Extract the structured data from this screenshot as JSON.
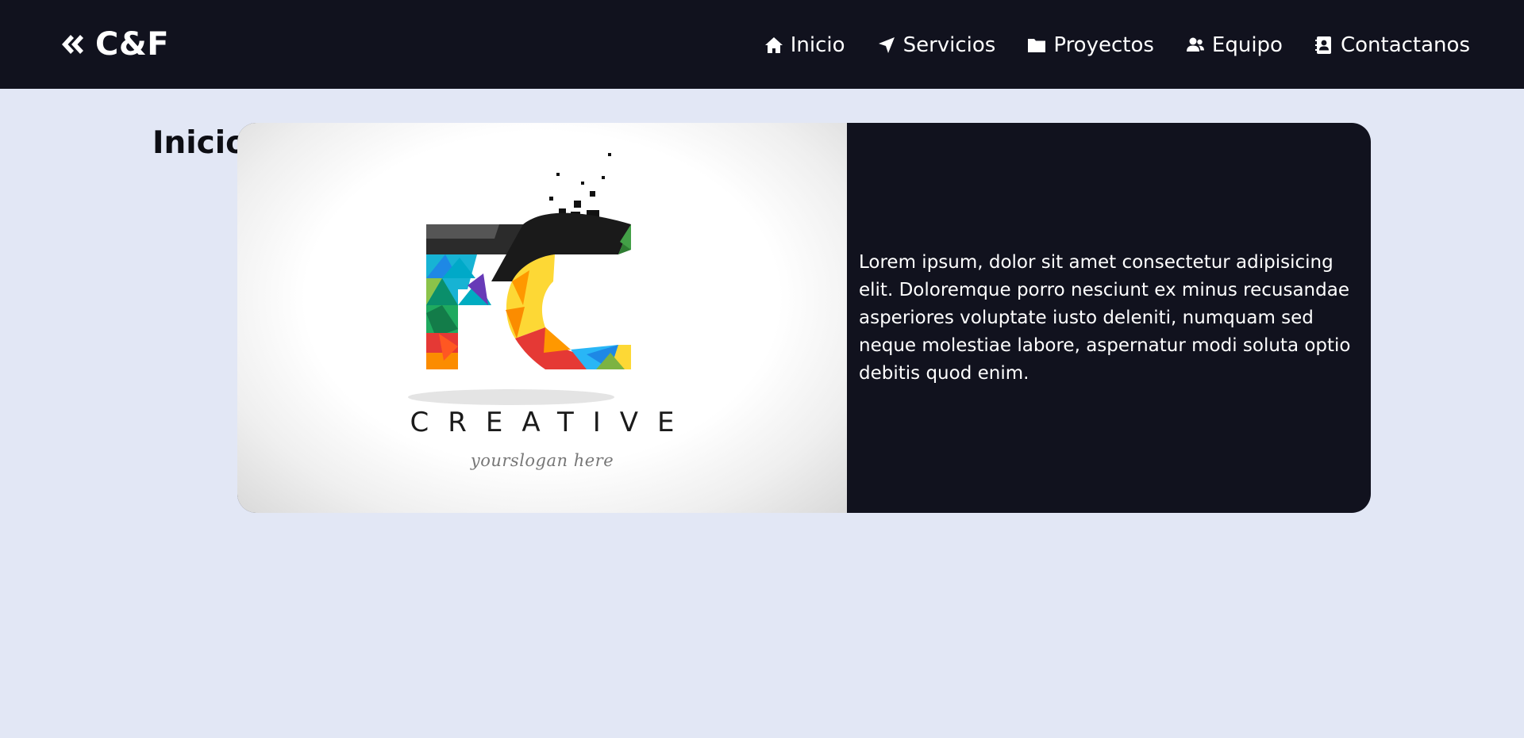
{
  "header": {
    "brand": {
      "text": "C&F",
      "icon": "double-chevron-left-icon"
    },
    "nav": [
      {
        "label": "Inicio",
        "icon": "home-icon"
      },
      {
        "label": "Servicios",
        "icon": "location-arrow-icon"
      },
      {
        "label": "Proyectos",
        "icon": "folder-icon"
      },
      {
        "label": "Equipo",
        "icon": "users-icon"
      },
      {
        "label": "Contactanos",
        "icon": "address-book-icon"
      }
    ]
  },
  "main": {
    "title": "Inicio",
    "card": {
      "image": {
        "wordmark": "CREATIVE",
        "slogan": "yourslogan here",
        "logo_letters": "FC"
      },
      "text": "Lorem ipsum, dolor sit amet consectetur adipisicing elit. Doloremque porro nesciunt ex minus recusandae asperiores voluptate iusto deleniti, numquam sed neque molestiae labore, aspernatur modi soluta optio debitis quod enim."
    }
  },
  "colors": {
    "header_bg": "#11121e",
    "page_bg": "#e2e7f5",
    "card_text_bg": "#11121e",
    "text_light": "#ffffff"
  }
}
